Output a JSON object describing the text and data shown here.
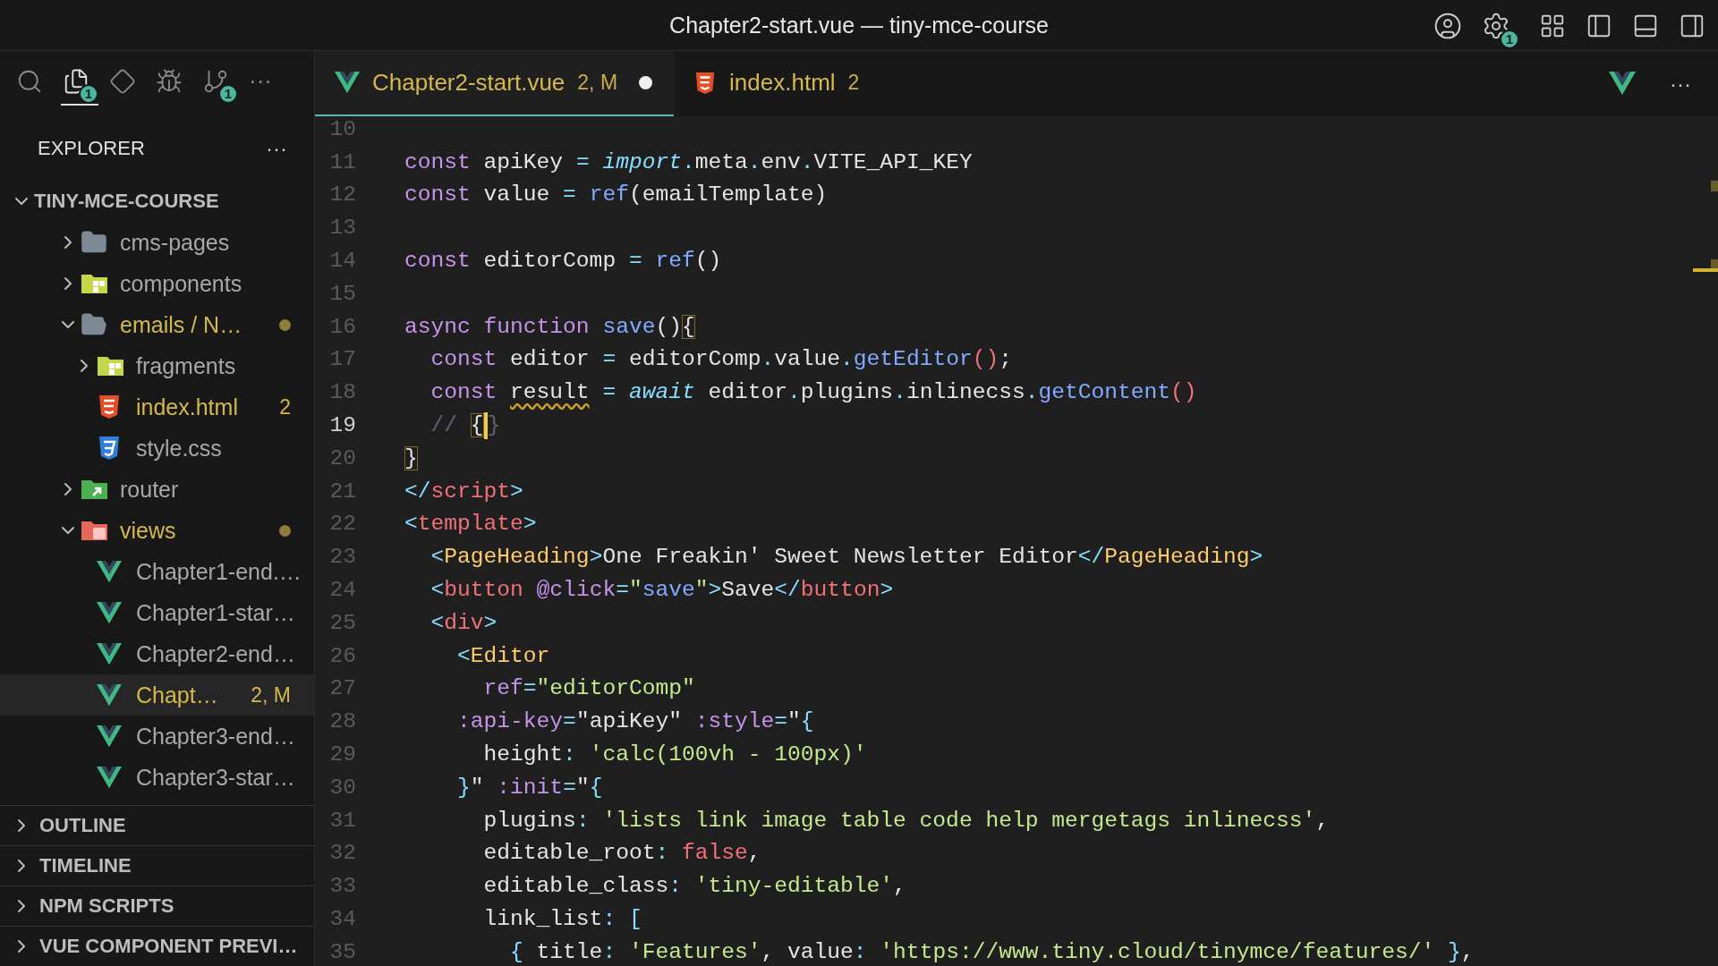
{
  "window": {
    "title": "Chapter2-start.vue — tiny-mce-course",
    "settings_badge": "1"
  },
  "activity_bar": [
    {
      "kind": "search",
      "selected": false
    },
    {
      "kind": "explorer",
      "selected": true,
      "badge": "1"
    },
    {
      "kind": "diamond",
      "selected": false
    },
    {
      "kind": "debug",
      "selected": false
    },
    {
      "kind": "scm",
      "selected": false,
      "badge": "1"
    },
    {
      "kind": "more",
      "selected": false,
      "text": "···"
    }
  ],
  "explorer": {
    "title": "EXPLORER",
    "more": "···",
    "root": {
      "label": "TINY-MCE-COURSE",
      "expanded": true,
      "children": [
        {
          "label": "cms-pages",
          "kind": "folder",
          "expanded": false,
          "modified": false,
          "selected": false
        },
        {
          "label": "components",
          "kind": "components",
          "expanded": false,
          "modified": false,
          "selected": false
        },
        {
          "label": "emails / N…",
          "kind": "folder",
          "expanded": true,
          "modified": true,
          "dot": true,
          "selected": false,
          "children": [
            {
              "label": "fragments",
              "kind": "components",
              "expanded": false,
              "modified": false,
              "selected": false
            },
            {
              "label": "index.html",
              "kind": "html",
              "modified": true,
              "badge": "2",
              "selected": false
            },
            {
              "label": "style.css",
              "kind": "css",
              "modified": false,
              "selected": false
            }
          ]
        },
        {
          "label": "router",
          "kind": "router",
          "expanded": false,
          "modified": false,
          "selected": false
        },
        {
          "label": "views",
          "kind": "views",
          "expanded": true,
          "modified": true,
          "dot": true,
          "selected": false,
          "children": [
            {
              "label": "Chapter1-end.…",
              "kind": "vue",
              "modified": false,
              "selected": false
            },
            {
              "label": "Chapter1-star…",
              "kind": "vue",
              "modified": false,
              "selected": false
            },
            {
              "label": "Chapter2-end…",
              "kind": "vue",
              "modified": false,
              "selected": false
            },
            {
              "label": "Chapt…",
              "kind": "vue",
              "modified": true,
              "badge": "2, M",
              "selected": true
            },
            {
              "label": "Chapter3-end…",
              "kind": "vue",
              "modified": false,
              "selected": false
            },
            {
              "label": "Chapter3-star…",
              "kind": "vue",
              "modified": false,
              "selected": false
            }
          ]
        }
      ]
    }
  },
  "sections": [
    {
      "label": "OUTLINE",
      "expanded": false
    },
    {
      "label": "TIMELINE",
      "expanded": false
    },
    {
      "label": "NPM SCRIPTS",
      "expanded": false
    },
    {
      "label": "VUE COMPONENT PREVI…",
      "expanded": false
    }
  ],
  "tabs": [
    {
      "label": "Chapter2-start.vue",
      "kind": "vue",
      "decoration": "2, M",
      "dirty": true,
      "selected": true
    },
    {
      "label": "index.html",
      "kind": "html",
      "decoration": "2",
      "dirty": false,
      "selected": false
    }
  ],
  "editor_actions": {
    "more": "···"
  },
  "code": [
    {
      "number": "10",
      "current": false
    },
    {
      "number": "11",
      "current": false,
      "tokens": [
        {
          "kind": "keyword",
          "text": "const"
        },
        {
          "kind": "ident",
          "text": " apiKey "
        },
        {
          "kind": "op",
          "text": "="
        },
        {
          "kind": "italic",
          "text": " import"
        },
        {
          "kind": "op",
          "text": "."
        },
        {
          "kind": "ident",
          "text": "meta"
        },
        {
          "kind": "op",
          "text": "."
        },
        {
          "kind": "ident",
          "text": "env"
        },
        {
          "kind": "op",
          "text": "."
        },
        {
          "kind": "ident",
          "text": "VITE_API_KEY"
        }
      ]
    },
    {
      "number": "12",
      "current": false,
      "tokens": [
        {
          "kind": "keyword",
          "text": "const"
        },
        {
          "kind": "ident",
          "text": " value "
        },
        {
          "kind": "op",
          "text": "="
        },
        {
          "kind": "func",
          "text": " ref"
        },
        {
          "kind": "ident",
          "text": "(emailTemplate)"
        }
      ]
    },
    {
      "number": "13",
      "current": false
    },
    {
      "number": "14",
      "current": false,
      "tokens": [
        {
          "kind": "keyword",
          "text": "const"
        },
        {
          "kind": "ident",
          "text": " editorComp "
        },
        {
          "kind": "op",
          "text": "="
        },
        {
          "kind": "func",
          "text": " ref"
        },
        {
          "kind": "ident",
          "text": "()"
        }
      ]
    },
    {
      "number": "15",
      "current": false
    },
    {
      "number": "16",
      "current": false,
      "tokens": [
        {
          "kind": "keyword",
          "text": "async function"
        },
        {
          "kind": "func",
          "text": " save"
        },
        {
          "kind": "ident",
          "text": "()"
        },
        {
          "kind": "match",
          "text": "{"
        }
      ]
    },
    {
      "number": "17",
      "current": false,
      "tokens": [
        {
          "kind": "keyword",
          "text": "  const"
        },
        {
          "kind": "ident",
          "text": " editor "
        },
        {
          "kind": "op",
          "text": "="
        },
        {
          "kind": "ident",
          "text": " editorComp"
        },
        {
          "kind": "op",
          "text": "."
        },
        {
          "kind": "ident",
          "text": "value"
        },
        {
          "kind": "op",
          "text": "."
        },
        {
          "kind": "func",
          "text": "getEditor"
        },
        {
          "kind": "paren",
          "text": "()"
        },
        {
          "kind": "ident",
          "text": ";"
        }
      ]
    },
    {
      "number": "18",
      "current": false,
      "tokens": [
        {
          "kind": "keyword",
          "text": "  const "
        },
        {
          "kind": "warning",
          "text": "result"
        },
        {
          "kind": "op",
          "text": " ="
        },
        {
          "kind": "italic",
          "text": " await"
        },
        {
          "kind": "ident",
          "text": " editor"
        },
        {
          "kind": "op",
          "text": "."
        },
        {
          "kind": "ident",
          "text": "plugins"
        },
        {
          "kind": "op",
          "text": "."
        },
        {
          "kind": "ident",
          "text": "inlinecss"
        },
        {
          "kind": "op",
          "text": "."
        },
        {
          "kind": "func",
          "text": "getContent"
        },
        {
          "kind": "paren",
          "text": "()"
        }
      ]
    },
    {
      "number": "19",
      "current": true,
      "tokens": [
        {
          "kind": "comment",
          "text": "  // "
        },
        {
          "kind": "match",
          "text": "{",
          "caret": true
        },
        {
          "kind": "comment",
          "text": "}"
        }
      ]
    },
    {
      "number": "20",
      "current": false,
      "tokens": [
        {
          "kind": "match",
          "text": "}"
        }
      ]
    },
    {
      "number": "21",
      "current": false,
      "tokens": [
        {
          "kind": "op",
          "text": "</"
        },
        {
          "kind": "tag",
          "text": "script"
        },
        {
          "kind": "op",
          "text": ">"
        }
      ]
    },
    {
      "number": "22",
      "current": false,
      "tokens": [
        {
          "kind": "op",
          "text": "<"
        },
        {
          "kind": "tag",
          "text": "template"
        },
        {
          "kind": "op",
          "text": ">"
        }
      ]
    },
    {
      "number": "23",
      "current": false,
      "tokens": [
        {
          "kind": "op",
          "text": "  <"
        },
        {
          "kind": "component",
          "text": "PageHeading"
        },
        {
          "kind": "op",
          "text": ">"
        },
        {
          "kind": "ident",
          "text": "One Freakin' Sweet Newsletter Editor"
        },
        {
          "kind": "op",
          "text": "</"
        },
        {
          "kind": "component",
          "text": "PageHeading"
        },
        {
          "kind": "op",
          "text": ">"
        }
      ]
    },
    {
      "number": "24",
      "current": false,
      "tokens": [
        {
          "kind": "op",
          "text": "  <"
        },
        {
          "kind": "tag",
          "text": "button"
        },
        {
          "kind": "attr",
          "text": " @click"
        },
        {
          "kind": "op",
          "text": "="
        },
        {
          "kind": "string",
          "text": "\""
        },
        {
          "kind": "func",
          "text": "save"
        },
        {
          "kind": "string",
          "text": "\""
        },
        {
          "kind": "op",
          "text": ">"
        },
        {
          "kind": "ident",
          "text": "Save"
        },
        {
          "kind": "op",
          "text": "</"
        },
        {
          "kind": "tag",
          "text": "button"
        },
        {
          "kind": "op",
          "text": ">"
        }
      ]
    },
    {
      "number": "25",
      "current": false,
      "tokens": [
        {
          "kind": "op",
          "text": "  <"
        },
        {
          "kind": "tag",
          "text": "div"
        },
        {
          "kind": "op",
          "text": ">"
        }
      ]
    },
    {
      "number": "26",
      "current": false,
      "tokens": [
        {
          "kind": "op",
          "text": "    <"
        },
        {
          "kind": "component",
          "text": "Editor"
        }
      ]
    },
    {
      "number": "27",
      "current": false,
      "tokens": [
        {
          "kind": "attr",
          "text": "      ref"
        },
        {
          "kind": "op",
          "text": "="
        },
        {
          "kind": "string",
          "text": "\"editorComp\""
        }
      ]
    },
    {
      "number": "28",
      "current": false,
      "tokens": [
        {
          "kind": "attr",
          "text": "    :api-key"
        },
        {
          "kind": "op",
          "text": "="
        },
        {
          "kind": "ident",
          "text": "\"apiKey\""
        },
        {
          "kind": "attr",
          "text": " :style"
        },
        {
          "kind": "op",
          "text": "="
        },
        {
          "kind": "ident",
          "text": "\""
        },
        {
          "kind": "op",
          "text": "{"
        }
      ]
    },
    {
      "number": "29",
      "current": false,
      "tokens": [
        {
          "kind": "ident",
          "text": "      height"
        },
        {
          "kind": "op",
          "text": ":"
        },
        {
          "kind": "string",
          "text": " 'calc(100vh - 100px)'"
        }
      ]
    },
    {
      "number": "30",
      "current": false,
      "tokens": [
        {
          "kind": "op",
          "text": "    }"
        },
        {
          "kind": "ident",
          "text": "\""
        },
        {
          "kind": "attr",
          "text": " :init"
        },
        {
          "kind": "op",
          "text": "="
        },
        {
          "kind": "ident",
          "text": "\""
        },
        {
          "kind": "op",
          "text": "{"
        }
      ]
    },
    {
      "number": "31",
      "current": false,
      "tokens": [
        {
          "kind": "ident",
          "text": "      plugins"
        },
        {
          "kind": "op",
          "text": ":"
        },
        {
          "kind": "string",
          "text": " 'lists link image table code help mergetags inlinecss'"
        },
        {
          "kind": "ident",
          "text": ","
        }
      ]
    },
    {
      "number": "32",
      "current": false,
      "tokens": [
        {
          "kind": "ident",
          "text": "      editable_root"
        },
        {
          "kind": "op",
          "text": ":"
        },
        {
          "kind": "bool",
          "text": " false"
        },
        {
          "kind": "ident",
          "text": ","
        }
      ]
    },
    {
      "number": "33",
      "current": false,
      "tokens": [
        {
          "kind": "ident",
          "text": "      editable_class"
        },
        {
          "kind": "op",
          "text": ":"
        },
        {
          "kind": "string",
          "text": " 'tiny-editable'"
        },
        {
          "kind": "ident",
          "text": ","
        }
      ]
    },
    {
      "number": "34",
      "current": false,
      "tokens": [
        {
          "kind": "ident",
          "text": "      link_list"
        },
        {
          "kind": "op",
          "text": ":"
        },
        {
          "kind": "op",
          "text": " ["
        }
      ]
    },
    {
      "number": "35",
      "current": false,
      "tokens": [
        {
          "kind": "op",
          "text": "        {"
        },
        {
          "kind": "ident",
          "text": " title"
        },
        {
          "kind": "op",
          "text": ":"
        },
        {
          "kind": "string",
          "text": " 'Features'"
        },
        {
          "kind": "ident",
          "text": ", value"
        },
        {
          "kind": "op",
          "text": ":"
        },
        {
          "kind": "string",
          "text": " 'https://www.tiny.cloud/tinymce/features/'"
        },
        {
          "kind": "op",
          "text": " }"
        },
        {
          "kind": "ident",
          "text": ","
        }
      ]
    }
  ]
}
